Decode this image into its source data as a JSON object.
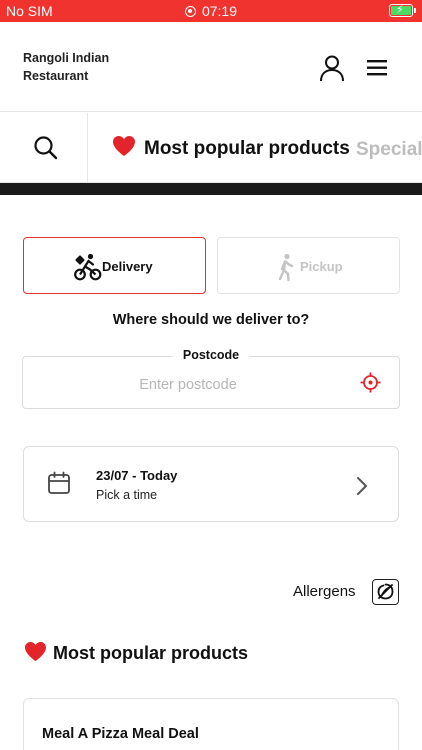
{
  "status_bar": {
    "carrier": "No SIM",
    "time": "07:19",
    "colors": {
      "background": "#f0332f",
      "battery": "#4cd964"
    }
  },
  "header": {
    "brand": "Rangoli Indian Restaurant",
    "icons": [
      "user-icon",
      "hamburger-menu-icon"
    ]
  },
  "category_bar": {
    "search_icon": "search-icon",
    "active_category": "Most popular products",
    "next_category": "Special"
  },
  "order_type": {
    "delivery_label": "Delivery",
    "pickup_label": "Pickup",
    "selected": "Delivery",
    "accent": "#e0352b"
  },
  "address": {
    "title": "Where should we deliver to?",
    "postcode_label": "Postcode",
    "postcode_placeholder": "Enter postcode",
    "postcode_value": ""
  },
  "time_slot": {
    "date": "23/07 - Today",
    "subtitle": "Pick a time"
  },
  "allergens": {
    "label": "Allergens"
  },
  "section": {
    "title": "Most popular products"
  },
  "products": [
    {
      "name": "Meal A Pizza Meal Deal",
      "description": ""
    }
  ]
}
